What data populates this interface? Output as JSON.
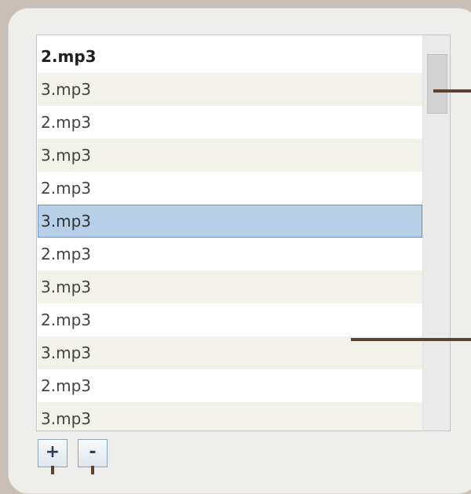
{
  "list": {
    "header": "2.mp3",
    "items": [
      "3.mp3",
      "2.mp3",
      "3.mp3",
      "2.mp3",
      "3.mp3",
      "2.mp3",
      "3.mp3",
      "2.mp3",
      "3.mp3",
      "2.mp3",
      "3.mp3"
    ],
    "selected_index": 4
  },
  "buttons": {
    "add_label": "+",
    "remove_label": "-"
  },
  "scrollbar": {
    "thumb_position": 0.0
  },
  "colors": {
    "background": "#c9bfb7",
    "panel": "#eeeeec",
    "selection": "#b8cfe8",
    "selection_border": "#6f8fbf",
    "stripe": "#f2f1ea",
    "callout": "#5b4331"
  }
}
